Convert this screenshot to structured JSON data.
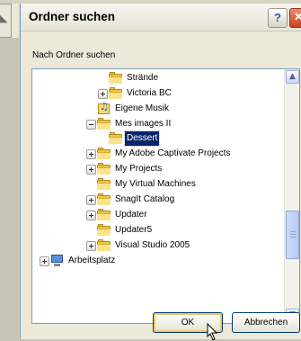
{
  "dialog": {
    "title": "Ordner suchen",
    "help_label": "?",
    "prompt": "Nach Ordner suchen",
    "ok_label": "OK",
    "cancel_label": "Abbrechen"
  },
  "tree": {
    "items": [
      {
        "label": "Strände",
        "icon": "folder-icon",
        "expander": "none",
        "selected": false
      },
      {
        "label": "Victoria BC",
        "icon": "folder-icon",
        "expander": "plus",
        "selected": false
      },
      {
        "label": "Eigene Musik",
        "icon": "music-folder-icon",
        "expander": "none",
        "selected": false
      },
      {
        "label": "Mes images II",
        "icon": "folder-icon",
        "expander": "minus",
        "selected": false
      },
      {
        "label": "Dessert",
        "icon": "open-folder-icon",
        "expander": "none",
        "selected": true
      },
      {
        "label": "My Adobe Captivate Projects",
        "icon": "folder-icon",
        "expander": "plus",
        "selected": false
      },
      {
        "label": "My Projects",
        "icon": "folder-icon",
        "expander": "plus",
        "selected": false
      },
      {
        "label": "My Virtual Machines",
        "icon": "folder-icon",
        "expander": "none",
        "selected": false
      },
      {
        "label": "SnagIt Catalog",
        "icon": "folder-icon",
        "expander": "plus",
        "selected": false
      },
      {
        "label": "Updater",
        "icon": "folder-icon",
        "expander": "plus",
        "selected": false
      },
      {
        "label": "Updater5",
        "icon": "folder-icon",
        "expander": "none",
        "selected": false
      },
      {
        "label": "Visual Studio 2005",
        "icon": "folder-icon",
        "expander": "plus",
        "selected": false
      },
      {
        "label": "Arbeitsplatz",
        "icon": "computer-icon",
        "expander": "plus",
        "selected": false
      }
    ]
  },
  "colors": {
    "selection": "#0a246a",
    "tree_border": "#7f9db9",
    "dialog_bg": "#ece9d8",
    "close_button": "#c84421"
  }
}
